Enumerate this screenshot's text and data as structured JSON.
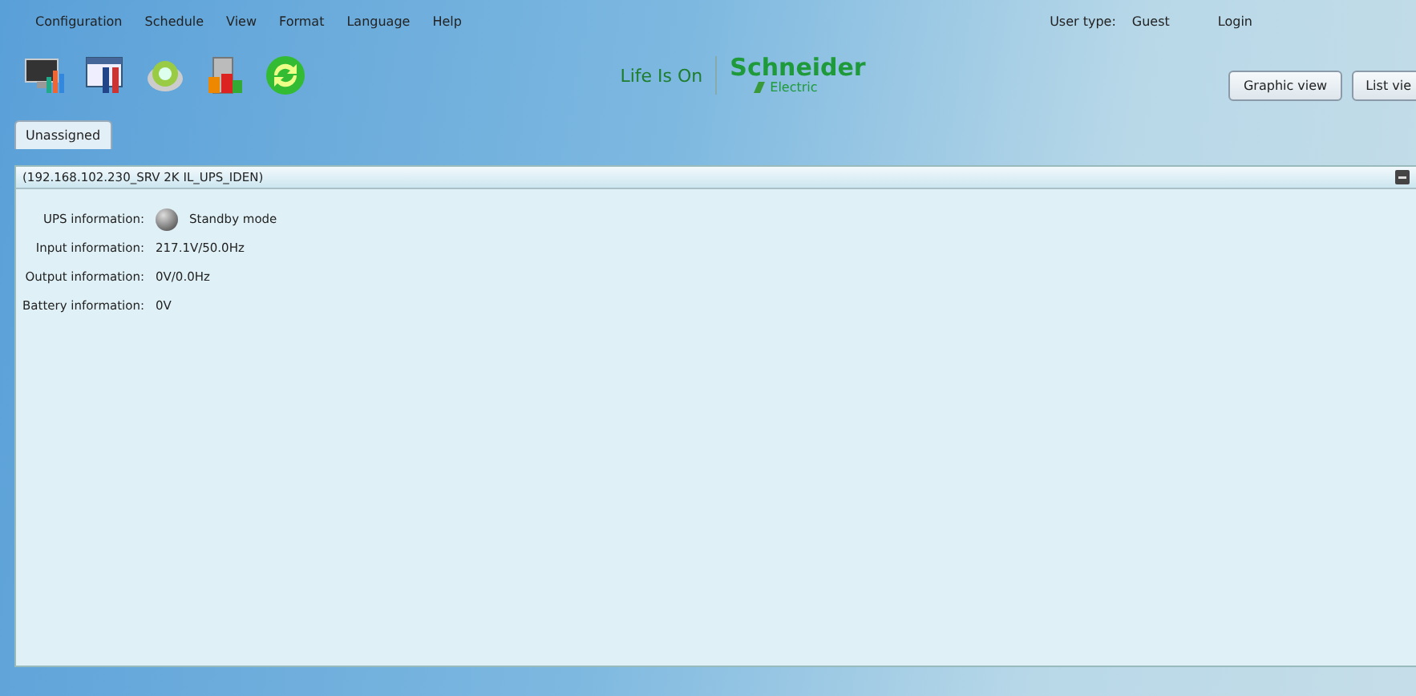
{
  "menu": [
    "Configuration",
    "Schedule",
    "View",
    "Format",
    "Language",
    "Help"
  ],
  "user": {
    "label": "User type:",
    "value": "Guest",
    "login": "Login"
  },
  "toolbar": [
    {
      "kind": "monitor"
    },
    {
      "kind": "tools"
    },
    {
      "kind": "disc"
    },
    {
      "kind": "server"
    },
    {
      "kind": "refresh"
    }
  ],
  "logo": {
    "slogan": "Life Is On",
    "brand": "Schneider",
    "sub": "Electric"
  },
  "view_buttons": [
    "Graphic view",
    "List vie"
  ],
  "tabs": [
    {
      "label": "Unassigned",
      "selected": true
    }
  ],
  "panel": {
    "title": "(192.168.102.230_SRV 2K IL_UPS_IDEN)",
    "rows": [
      {
        "label": "UPS information:",
        "value": "Standby mode",
        "kind": "status"
      },
      {
        "label": "Input information:",
        "value": "217.1V/50.0Hz",
        "kind": "text"
      },
      {
        "label": "Output information:",
        "value": "0V/0.0Hz",
        "kind": "text"
      },
      {
        "label": "Battery information:",
        "value": "0V",
        "kind": "text"
      }
    ]
  }
}
